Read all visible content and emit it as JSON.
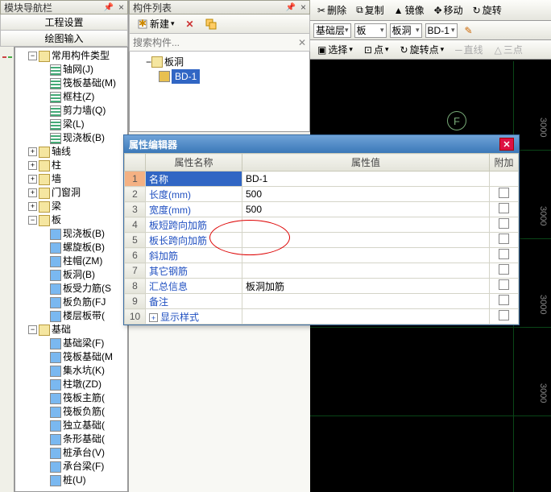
{
  "left_panel": {
    "title": "模块导航栏",
    "tab1": "工程设置",
    "tab2": "绘图输入"
  },
  "tree": {
    "root": "常用构件类型",
    "items": [
      {
        "t": "轴网(J)"
      },
      {
        "t": "筏板基础(M)"
      },
      {
        "t": "框柱(Z)"
      },
      {
        "t": "剪力墙(Q)"
      },
      {
        "t": "梁(L)"
      },
      {
        "t": "现浇板(B)"
      }
    ],
    "groups": [
      {
        "t": "轴线",
        "exp": "+"
      },
      {
        "t": "柱",
        "exp": "+"
      },
      {
        "t": "墙",
        "exp": "+"
      },
      {
        "t": "门窗洞",
        "exp": "+"
      },
      {
        "t": "梁",
        "exp": "+"
      },
      {
        "t": "板",
        "exp": "−",
        "children": [
          {
            "t": "现浇板(B)"
          },
          {
            "t": "螺旋板(B)"
          },
          {
            "t": "柱帽(ZM)"
          },
          {
            "t": "板洞(B)"
          },
          {
            "t": "板受力筋(S"
          },
          {
            "t": "板负筋(FJ"
          },
          {
            "t": "楼层板带("
          }
        ]
      },
      {
        "t": "基础",
        "exp": "−",
        "children": [
          {
            "t": "基础梁(F)"
          },
          {
            "t": "筏板基础(M"
          },
          {
            "t": "集水坑(K)"
          },
          {
            "t": "柱墩(ZD)"
          },
          {
            "t": "筏板主筋("
          },
          {
            "t": "筏板负筋("
          },
          {
            "t": "独立基础("
          },
          {
            "t": "条形基础("
          },
          {
            "t": "桩承台(V)"
          },
          {
            "t": "承台梁(F)"
          },
          {
            "t": "桩(U)"
          }
        ]
      }
    ]
  },
  "mid_panel": {
    "title": "构件列表",
    "new_btn": "新建",
    "search_ph": "搜索构件...",
    "root": "板洞",
    "item": "BD-1"
  },
  "right": {
    "tools": [
      {
        "t": "删除"
      },
      {
        "t": "复制"
      },
      {
        "t": "镜像"
      },
      {
        "t": "移动"
      },
      {
        "t": "旋转"
      }
    ],
    "selects": [
      {
        "v": "基础层"
      },
      {
        "v": "板"
      },
      {
        "v": "板洞"
      },
      {
        "v": "BD-1"
      }
    ],
    "tools2": [
      {
        "t": "选择"
      },
      {
        "t": "点"
      },
      {
        "t": "旋转点"
      },
      {
        "t": "直线"
      },
      {
        "t": "三点"
      }
    ],
    "axis": [
      "3000",
      "3000",
      "3000",
      "3000"
    ],
    "bubble": "F"
  },
  "dialog": {
    "title": "属性编辑器",
    "col_name": "属性名称",
    "col_val": "属性值",
    "col_add": "附加",
    "rows": [
      {
        "n": "1",
        "p": "名称",
        "v": "BD-1",
        "chk": false
      },
      {
        "n": "2",
        "p": "长度(mm)",
        "v": "500",
        "chk": true
      },
      {
        "n": "3",
        "p": "宽度(mm)",
        "v": "500",
        "chk": true
      },
      {
        "n": "4",
        "p": "板短跨向加筋",
        "v": "",
        "chk": true
      },
      {
        "n": "5",
        "p": "板长跨向加筋",
        "v": "",
        "chk": true
      },
      {
        "n": "6",
        "p": "斜加筋",
        "v": "",
        "chk": true
      },
      {
        "n": "7",
        "p": "其它钢筋",
        "v": "",
        "chk": false
      },
      {
        "n": "8",
        "p": "汇总信息",
        "v": "板洞加筋",
        "chk": true
      },
      {
        "n": "9",
        "p": "备注",
        "v": "",
        "chk": true
      },
      {
        "n": "10",
        "p": "显示样式",
        "v": "",
        "chk": false,
        "expand": true
      }
    ]
  }
}
